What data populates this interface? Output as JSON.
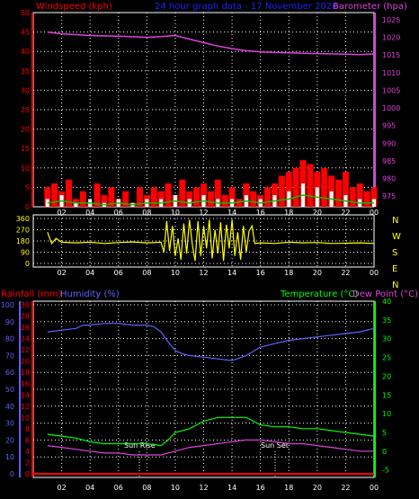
{
  "header": {
    "left": "Windspeed (kph)",
    "center": "24 hour graph data - 17 November 2024",
    "right": "Barometer (hpa)"
  },
  "bottom_header": {
    "rainfall": "Rainfall (mm)",
    "humidity": "Humidity (%)",
    "temperature": "Temperature (°C)",
    "dewpoint": "Dew Point (°C)"
  },
  "compass": [
    "N",
    "W",
    "S",
    "E",
    "N"
  ],
  "annotations": {
    "sunrise": "Sun Rise",
    "sunset": "Sun Set"
  },
  "colors": {
    "wind": "#ff0000",
    "gust": "#ffffff",
    "wind_avg": "#00c000",
    "barometer": "#e040e0",
    "direction": "#ffff00",
    "humidity": "#6060ff",
    "temperature": "#00ff00",
    "dewpoint": "#e040e0",
    "rain": "#ff0000"
  },
  "chart_data": [
    {
      "type": "line",
      "name": "wind-barometer",
      "x_ticks": [
        "02",
        "04",
        "06",
        "08",
        "10",
        "12",
        "14",
        "16",
        "18",
        "20",
        "22",
        "00"
      ],
      "left_axis": {
        "label": "Windspeed (kph)",
        "ticks": [
          0,
          5,
          10,
          15,
          20,
          25,
          30,
          35,
          40,
          45,
          50
        ],
        "ylim": [
          0,
          50
        ]
      },
      "right_axis": {
        "label": "Barometer (hpa)",
        "ticks": [
          975,
          980,
          985,
          990,
          995,
          1000,
          1005,
          1010,
          1015,
          1020,
          1025
        ],
        "ylim": [
          972,
          1027
        ]
      },
      "series": [
        {
          "name": "Barometer (hpa)",
          "x": [
            1,
            2,
            4,
            6,
            8,
            9,
            10,
            11,
            12,
            13,
            14,
            15,
            16,
            17,
            18,
            19,
            20,
            21,
            22,
            23,
            24
          ],
          "values": [
            1021.5,
            1021,
            1020.5,
            1020.3,
            1020,
            1020.2,
            1020.5,
            1019.5,
            1018.5,
            1017.5,
            1016.8,
            1016.2,
            1015.9,
            1015.7,
            1015.6,
            1015.5,
            1015.4,
            1015.3,
            1015.2,
            1015.1,
            1015.3
          ]
        },
        {
          "name": "Windspeed (kph)",
          "x": [
            1,
            1.5,
            2,
            2.5,
            3,
            3.5,
            4,
            4.5,
            5,
            5.5,
            6,
            6.5,
            7,
            7.5,
            8,
            8.5,
            9,
            9.5,
            10,
            10.5,
            11,
            11.5,
            12,
            12.5,
            13,
            13.5,
            14,
            14.5,
            15,
            15.5,
            16,
            16.5,
            17,
            17.5,
            18,
            18.5,
            19,
            19.5,
            20,
            20.5,
            21,
            21.5,
            22,
            22.5,
            23,
            23.5,
            24
          ],
          "values": [
            5,
            6,
            4,
            7,
            2,
            4,
            1,
            6,
            3,
            5,
            2,
            4,
            1,
            5,
            3,
            5,
            4,
            6,
            3,
            7,
            4,
            5,
            6,
            4,
            7,
            3,
            5,
            2,
            6,
            4,
            3,
            5,
            6,
            8,
            9,
            10,
            12,
            11,
            9,
            10,
            8,
            7,
            9,
            5,
            6,
            4,
            5
          ]
        },
        {
          "name": "Gust",
          "x": [
            1,
            2,
            3,
            4,
            5,
            6,
            7,
            8,
            9,
            10,
            11,
            12,
            13,
            14,
            15,
            16,
            17,
            18,
            19,
            20,
            21,
            22,
            23,
            24
          ],
          "values": [
            2,
            3,
            1,
            2,
            1,
            2,
            1,
            2,
            2,
            3,
            2,
            3,
            2,
            2,
            3,
            2,
            3,
            4,
            6,
            5,
            4,
            3,
            2,
            2
          ]
        },
        {
          "name": "Wind average",
          "x": [
            1,
            2,
            3,
            4,
            5,
            6,
            7,
            8,
            9,
            10,
            11,
            12,
            13,
            14,
            15,
            16,
            17,
            18,
            19,
            20,
            21,
            22,
            23,
            24
          ],
          "values": [
            1,
            1.5,
            1,
            1,
            0.5,
            1,
            0.5,
            1,
            1,
            1.5,
            1,
            1.5,
            1,
            1,
            1.5,
            1,
            1.5,
            2,
            3,
            2.5,
            2,
            1.5,
            1,
            1
          ]
        }
      ]
    },
    {
      "type": "line",
      "name": "wind-direction",
      "x_ticks": [
        "02",
        "04",
        "06",
        "08",
        "10",
        "12",
        "14",
        "16",
        "18",
        "20",
        "22",
        "00"
      ],
      "left_axis": {
        "ticks": [
          0,
          90,
          180,
          270,
          360
        ],
        "ylim": [
          0,
          360
        ]
      },
      "series": [
        {
          "name": "Wind direction",
          "x": [
            1,
            1.3,
            1.6,
            2,
            3,
            4,
            5,
            6,
            7,
            8,
            9,
            9.2,
            9.4,
            9.6,
            9.8,
            10,
            10.2,
            10.4,
            10.6,
            10.8,
            11,
            11.2,
            11.4,
            11.6,
            11.8,
            12,
            12.2,
            12.4,
            12.6,
            12.8,
            13,
            13.2,
            13.4,
            13.6,
            13.8,
            14,
            14.2,
            14.4,
            14.6,
            14.8,
            15,
            15.2,
            15.4,
            15.6,
            16,
            17,
            18,
            19,
            20,
            21,
            22,
            23,
            24
          ],
          "values": [
            250,
            160,
            200,
            170,
            165,
            170,
            160,
            168,
            172,
            165,
            170,
            90,
            340,
            100,
            300,
            60,
            200,
            30,
            320,
            80,
            350,
            150,
            20,
            340,
            60,
            300,
            120,
            350,
            40,
            270,
            80,
            330,
            20,
            310,
            120,
            350,
            60,
            250,
            30,
            300,
            90,
            260,
            300,
            160,
            165,
            160,
            170,
            165,
            168,
            160,
            162,
            165,
            160
          ]
        }
      ]
    },
    {
      "type": "line",
      "name": "humidity-temperature",
      "x_ticks": [
        "02",
        "04",
        "06",
        "08",
        "10",
        "12",
        "14",
        "16",
        "18",
        "20",
        "22",
        "00"
      ],
      "left_axis": {
        "label": "Humidity (%)",
        "ticks": [
          0,
          10,
          20,
          30,
          40,
          50,
          60,
          70,
          80,
          90,
          100
        ],
        "ylim": [
          0,
          100
        ]
      },
      "rain_axis": {
        "label": "Rainfall (mm)",
        "ticks": [
          0,
          2,
          4,
          6,
          8,
          10,
          12,
          14,
          16,
          18,
          20,
          22,
          24,
          26,
          28,
          30
        ],
        "ylim": [
          0,
          30
        ]
      },
      "right_axis": {
        "label": "Temperature (°C)",
        "ticks": [
          -5,
          0,
          5,
          10,
          15,
          20,
          25,
          30,
          35,
          40
        ],
        "ylim": [
          -7,
          40
        ]
      },
      "series": [
        {
          "name": "Humidity (%)",
          "x": [
            1,
            2,
            3,
            3.5,
            4,
            5,
            6,
            7,
            8,
            8.5,
            9,
            9.5,
            10,
            10.5,
            11,
            12,
            13,
            14,
            15,
            16,
            17,
            18,
            19,
            20,
            21,
            22,
            23,
            24
          ],
          "values": [
            84,
            85,
            86,
            88,
            88,
            89,
            89,
            88,
            88,
            87,
            84,
            78,
            73,
            71,
            70,
            69,
            68,
            67,
            70,
            75,
            77,
            79,
            80,
            81,
            82,
            83,
            84,
            86
          ]
        },
        {
          "name": "Temperature (°C)",
          "x": [
            1,
            2,
            3,
            4,
            5,
            6,
            7,
            8,
            9,
            9.5,
            10,
            10.5,
            11,
            11.5,
            12,
            13,
            14,
            15,
            15.5,
            16,
            17,
            18,
            19,
            20,
            21,
            22,
            23,
            24
          ],
          "values": [
            4.5,
            4,
            3.5,
            2.5,
            2,
            2,
            2,
            2,
            1.5,
            3,
            5,
            5.5,
            6,
            7,
            8,
            9,
            9,
            9,
            8,
            7,
            6.5,
            6.5,
            6,
            6,
            5.5,
            5,
            4.5,
            4
          ]
        },
        {
          "name": "Dew Point (°C)",
          "x": [
            1,
            2,
            3,
            4,
            5,
            6,
            7,
            8,
            9,
            10,
            11,
            12,
            13,
            14,
            15,
            16,
            17,
            18,
            19,
            20,
            21,
            22,
            23,
            24
          ],
          "values": [
            1.5,
            1,
            0.5,
            0,
            -0.5,
            -0.5,
            -1,
            -1,
            -1,
            0,
            1,
            1.5,
            2,
            2.5,
            3,
            3,
            2.5,
            2,
            2,
            1.5,
            1,
            0.5,
            0,
            0
          ]
        },
        {
          "name": "Rainfall (mm)",
          "x": [
            0,
            24
          ],
          "values": [
            0,
            0
          ]
        }
      ]
    }
  ]
}
